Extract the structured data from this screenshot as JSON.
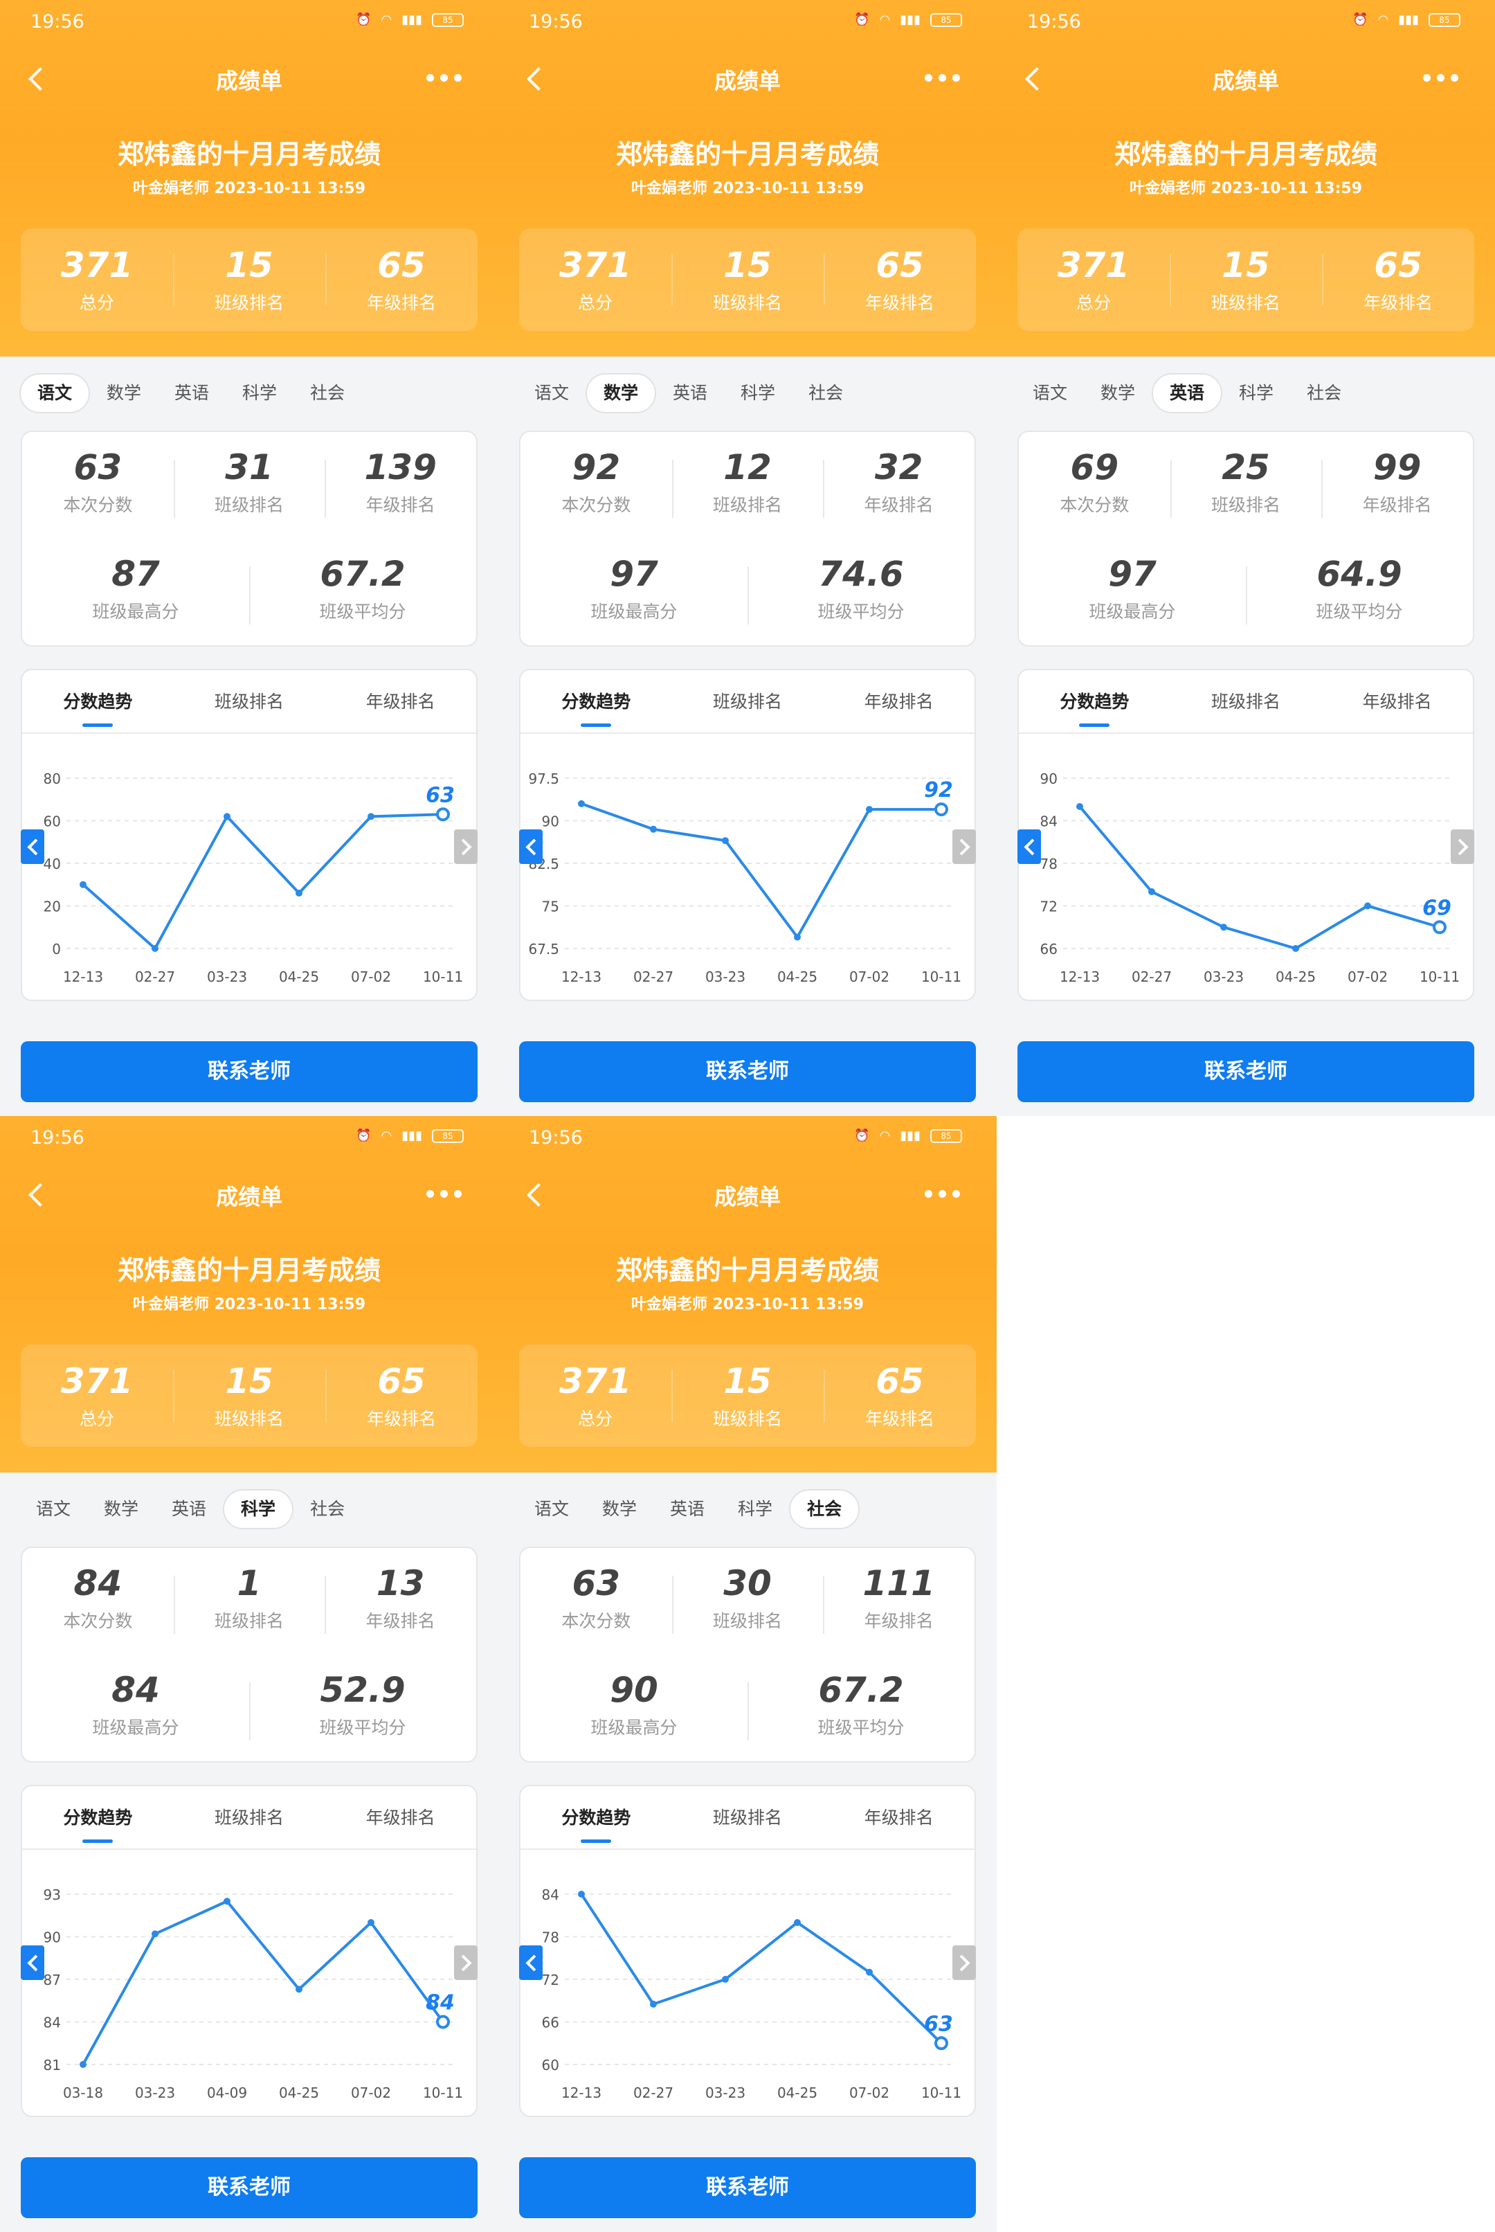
{
  "status": {
    "time": "19:56",
    "battery": "85"
  },
  "nav": {
    "title": "成绩单"
  },
  "exam": {
    "title": "郑炜鑫的十月月考成绩",
    "subtitle": "叶金娟老师 2023-10-11 13:59"
  },
  "summary": [
    {
      "value": "371",
      "label": "总分"
    },
    {
      "value": "15",
      "label": "班级排名"
    },
    {
      "value": "65",
      "label": "年级排名"
    }
  ],
  "subject_tabs": [
    "语文",
    "数学",
    "英语",
    "科学",
    "社会"
  ],
  "stat_labels": {
    "score": "本次分数",
    "class_rank": "班级排名",
    "grade_rank": "年级排名",
    "class_max": "班级最高分",
    "class_avg": "班级平均分"
  },
  "chart_tabs": [
    "分数趋势",
    "班级排名",
    "年级排名"
  ],
  "contact_label": "联系老师",
  "colors": {
    "header_orange": "#ffaf2c",
    "accent_blue": "#1a7ff0",
    "line_blue": "#2a8ae8"
  },
  "screens": [
    {
      "subject_index": 0,
      "stats": {
        "score": "63",
        "class_rank": "31",
        "grade_rank": "139",
        "class_max": "87",
        "class_avg": "67.2"
      }
    },
    {
      "subject_index": 1,
      "stats": {
        "score": "92",
        "class_rank": "12",
        "grade_rank": "32",
        "class_max": "97",
        "class_avg": "74.6"
      }
    },
    {
      "subject_index": 2,
      "stats": {
        "score": "69",
        "class_rank": "25",
        "grade_rank": "99",
        "class_max": "97",
        "class_avg": "64.9"
      }
    },
    {
      "subject_index": 3,
      "stats": {
        "score": "84",
        "class_rank": "1",
        "grade_rank": "13",
        "class_max": "84",
        "class_avg": "52.9"
      }
    },
    {
      "subject_index": 4,
      "stats": {
        "score": "63",
        "class_rank": "30",
        "grade_rank": "111",
        "class_max": "90",
        "class_avg": "67.2"
      }
    }
  ],
  "chart_data": [
    {
      "type": "line",
      "x": [
        "12-13",
        "02-27",
        "03-23",
        "04-25",
        "07-02",
        "10-11"
      ],
      "values": [
        30,
        0,
        62,
        26,
        62,
        63
      ],
      "ylim": [
        0,
        80
      ],
      "yticks": [
        "0",
        "20",
        "40",
        "60",
        "80"
      ],
      "highlight_label": "63",
      "grid": "horizontal-dashed"
    },
    {
      "type": "line",
      "x": [
        "12-13",
        "02-27",
        "03-23",
        "04-25",
        "07-02",
        "10-11"
      ],
      "values": [
        93,
        88.5,
        86.5,
        69.5,
        92,
        92
      ],
      "ylim": [
        67.5,
        97.5
      ],
      "yticks": [
        "67.5",
        "75",
        "82.5",
        "90",
        "97.5"
      ],
      "highlight_label": "92",
      "grid": "horizontal-dashed"
    },
    {
      "type": "line",
      "x": [
        "12-13",
        "02-27",
        "03-23",
        "04-25",
        "07-02",
        "10-11"
      ],
      "values": [
        86,
        74,
        69,
        66,
        72,
        69
      ],
      "ylim": [
        66,
        90
      ],
      "yticks": [
        "66",
        "72",
        "78",
        "84",
        "90"
      ],
      "highlight_label": "69",
      "grid": "horizontal-dashed"
    },
    {
      "type": "line",
      "x": [
        "03-18",
        "03-23",
        "04-09",
        "04-25",
        "07-02",
        "10-11"
      ],
      "values": [
        81,
        90.2,
        92.5,
        86.3,
        91,
        84
      ],
      "ylim": [
        81,
        93
      ],
      "yticks": [
        "81",
        "84",
        "87",
        "90",
        "93"
      ],
      "highlight_label": "84",
      "grid": "horizontal-dashed"
    },
    {
      "type": "line",
      "x": [
        "12-13",
        "02-27",
        "03-23",
        "04-25",
        "07-02",
        "10-11"
      ],
      "values": [
        84,
        68.5,
        72,
        80,
        73,
        63
      ],
      "ylim": [
        60,
        84
      ],
      "yticks": [
        "60",
        "66",
        "72",
        "78",
        "84"
      ],
      "highlight_label": "63",
      "grid": "horizontal-dashed"
    }
  ]
}
